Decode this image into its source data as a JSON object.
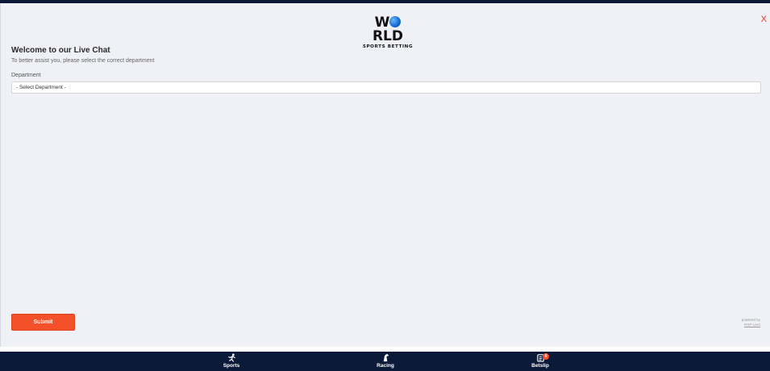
{
  "logo": {
    "word_left": "W",
    "word_right": "RLD",
    "tagline": "SPORTS BETTING"
  },
  "chat": {
    "close_label": "X",
    "title": "Welcome to our Live Chat",
    "subtitle": "To better assist you, please select the correct department",
    "department_label": "Department",
    "department_selected": "- Select Department -",
    "submit_label": "Submit",
    "powered_by": "powered by",
    "powered_link": "PHP Live!"
  },
  "bottom_nav": {
    "sports_label": "Sports",
    "racing_label": "Racing",
    "betslip_label": "Betslip",
    "betslip_count": "0"
  },
  "colors": {
    "accent": "#f4502a",
    "nav_bg": "#0c1a3a",
    "panel_bg": "#f0f1f6"
  }
}
